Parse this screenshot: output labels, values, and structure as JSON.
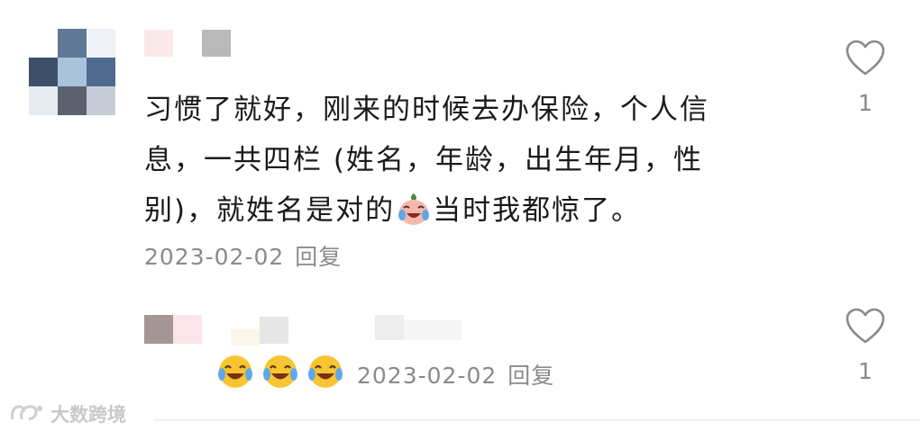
{
  "comment": {
    "lines": [
      "习惯了就好，刚来的时候去办保险，个人信",
      "息，一共四栏 (姓名，年龄，出生年月，性",
      "别)，就姓名是对的"
    ],
    "after_emoji": "当时我都惊了。",
    "inline_emoji": "crying-laughing-emoji",
    "date": "2023-02-02",
    "reply_label": "回复",
    "like_count": "1"
  },
  "reply": {
    "emojis": [
      "joy-emoji",
      "joy-emoji",
      "joy-emoji"
    ],
    "date": "2023-02-02",
    "reply_label": "回复",
    "like_count": "1"
  },
  "watermark": {
    "text": "大数跨境"
  },
  "colors": {
    "text": "#1a1a1a",
    "meta": "#8a8a8a",
    "avatar_dark": "#4a5d78",
    "avatar_mid": "#6f8aa8",
    "avatar_light": "#a9c1d9"
  }
}
